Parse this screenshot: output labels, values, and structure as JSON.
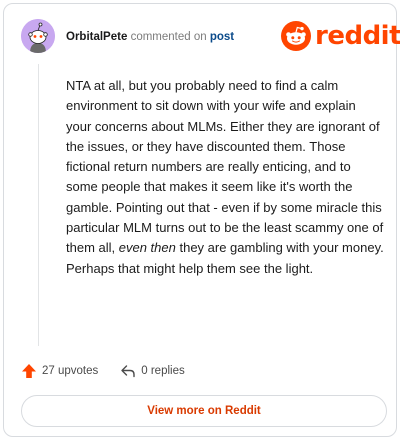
{
  "colors": {
    "brand": "#ff4500",
    "link": "#0a4a8a",
    "upvote": "#ff4500",
    "view_more_text": "#d93a00",
    "avatar_bg": "#c8a8f0"
  },
  "icons": {
    "avatar": "snoo-avatar-icon",
    "brand": "reddit-logo-icon",
    "upvote": "upvote-arrow-icon",
    "reply": "reply-arrow-icon"
  },
  "comment": {
    "username": "OrbitalPete",
    "action_text": "commented on",
    "post_link": "post",
    "body_before_em": "NTA at all, but you probably need to find a calm environment to sit down with your wife and explain your concerns about MLMs. Either they are ignorant of the issues, or they have discounted them. Those fictional return numbers are really enticing, and to some people that makes it seem like it's worth the gamble. Pointing out that - even if by some miracle this particular MLM turns out to be the least scammy one of them all, ",
    "body_em": "even then",
    "body_after_em": " they are gambling with your money. Perhaps that might help them see the light."
  },
  "brand": {
    "name": "reddit"
  },
  "actions": {
    "upvotes": "27 upvotes",
    "replies": "0 replies"
  },
  "footer": {
    "view_more_label": "View more on Reddit"
  }
}
